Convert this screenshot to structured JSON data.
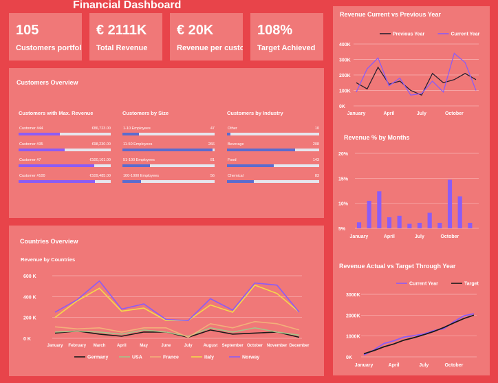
{
  "header": {
    "title": "Financial Dashboard"
  },
  "kpis": [
    {
      "value": "105",
      "label": "Customers portfolio"
    },
    {
      "value": "€ 2111K",
      "label": "Total Revenue"
    },
    {
      "value": "€ 20K",
      "label": "Revenue per customer"
    },
    {
      "value": "108%",
      "label": "Target Achieved"
    }
  ],
  "customers_overview": {
    "title": "Customers Overview",
    "blocks": [
      {
        "title": "Customers with Max. Revenue",
        "color": "#8b5cf6",
        "rows": [
          {
            "label": "Customer #44",
            "value": "€86,723.00",
            "fraction": 0.45
          },
          {
            "label": "Customer #35",
            "value": "€98,230.00",
            "fraction": 0.5
          },
          {
            "label": "Customer #7",
            "value": "€100,101.00",
            "fraction": 0.82
          },
          {
            "label": "Customer #100",
            "value": "€109,485.00",
            "fraction": 0.83
          }
        ]
      },
      {
        "title": "Customers by Size",
        "color": "#5b6ccf",
        "rows": [
          {
            "label": "1-10 Employees",
            "value": "47",
            "fraction": 0.18
          },
          {
            "label": "11-50 Employees",
            "value": "266",
            "fraction": 0.98
          },
          {
            "label": "51-100 Employees",
            "value": "81",
            "fraction": 0.3
          },
          {
            "label": "100-1000 Employees",
            "value": "56",
            "fraction": 0.2
          }
        ]
      },
      {
        "title": "Customers by Industry",
        "color": "#5b6ccf",
        "rows": [
          {
            "label": "Other",
            "value": "10",
            "fraction": 0.04
          },
          {
            "label": "Beverage",
            "value": "208",
            "fraction": 0.74
          },
          {
            "label": "Food",
            "value": "143",
            "fraction": 0.51
          },
          {
            "label": "Chemical",
            "value": "83",
            "fraction": 0.29
          }
        ]
      }
    ]
  },
  "countries_overview": {
    "title": "Countries Overview",
    "subtitle": "Revenue by Countries"
  },
  "chart_data": [
    {
      "type": "line",
      "title": "Revenue Current vs Previous Year",
      "x": [
        "January",
        "February",
        "March",
        "April",
        "May",
        "June",
        "July",
        "August",
        "September",
        "October",
        "November",
        "December"
      ],
      "xticks": [
        "January",
        "April",
        "July",
        "October"
      ],
      "yticks": [
        "0K",
        "100K",
        "200K",
        "300K",
        "400K"
      ],
      "ylim": [
        0,
        400
      ],
      "legend": "top",
      "series": [
        {
          "name": "Previous Year",
          "color": "#2a2030",
          "values": [
            150,
            110,
            250,
            140,
            160,
            100,
            70,
            210,
            150,
            170,
            210,
            170
          ]
        },
        {
          "name": "Current Year",
          "color": "#8b5cf6",
          "values": [
            90,
            240,
            310,
            130,
            180,
            70,
            80,
            160,
            90,
            340,
            280,
            100
          ]
        }
      ]
    },
    {
      "type": "bar",
      "title": "Revenue % by Months",
      "categories": [
        "January",
        "February",
        "March",
        "April",
        "May",
        "June",
        "July",
        "August",
        "September",
        "October",
        "November",
        "December"
      ],
      "xticks": [
        "January",
        "April",
        "July",
        "October"
      ],
      "yticks": [
        "5%",
        "10%",
        "15%",
        "20%"
      ],
      "ylim": [
        5,
        20
      ],
      "color": "#8b5cf6",
      "values": [
        6.2,
        10.5,
        12.4,
        7.2,
        7.5,
        5.9,
        6.1,
        8.1,
        6.1,
        14.7,
        11.4,
        6.1
      ]
    },
    {
      "type": "line",
      "title": "Revenue by Countries",
      "x": [
        "January",
        "February",
        "March",
        "April",
        "May",
        "June",
        "July",
        "August",
        "September",
        "October",
        "November",
        "December"
      ],
      "xticks": [
        "January",
        "February",
        "March",
        "April",
        "May",
        "June",
        "July",
        "August",
        "September",
        "October",
        "November",
        "December"
      ],
      "yticks": [
        "0 K",
        "200 K",
        "400 K",
        "600 K"
      ],
      "ylim": [
        0,
        600
      ],
      "legend": "bottom",
      "series": [
        {
          "name": "Germany",
          "color": "#1a1a1a",
          "values": [
            50,
            70,
            40,
            20,
            60,
            60,
            10,
            80,
            40,
            50,
            60,
            10
          ]
        },
        {
          "name": "USA",
          "color": "#a6c48a",
          "values": [
            60,
            70,
            60,
            40,
            80,
            60,
            20,
            100,
            60,
            100,
            60,
            30
          ]
        },
        {
          "name": "France",
          "color": "#f2b07a",
          "values": [
            110,
            90,
            100,
            60,
            100,
            100,
            10,
            140,
            100,
            160,
            140,
            80
          ]
        },
        {
          "name": "Italy",
          "color": "#f4d94a",
          "values": [
            200,
            360,
            480,
            260,
            290,
            170,
            170,
            320,
            250,
            510,
            430,
            250
          ]
        },
        {
          "name": "Norway",
          "color": "#8b5cf6",
          "values": [
            250,
            370,
            550,
            280,
            330,
            180,
            170,
            380,
            270,
            530,
            510,
            250
          ]
        }
      ]
    },
    {
      "type": "line",
      "title": "Revenue Actual vs Target Through Year",
      "x": [
        "January",
        "February",
        "March",
        "April",
        "May",
        "June",
        "July",
        "August",
        "September",
        "October",
        "November",
        "December"
      ],
      "xticks": [
        "January",
        "April",
        "July",
        "October"
      ],
      "yticks": [
        "0K",
        "1000K",
        "2000K",
        "3000K"
      ],
      "ylim": [
        0,
        3000
      ],
      "legend": "top",
      "series": [
        {
          "name": "Current Year",
          "color": "#8b5cf6",
          "values": [
            90,
            330,
            640,
            770,
            950,
            1020,
            1100,
            1260,
            1350,
            1690,
            1970,
            2070
          ]
        },
        {
          "name": "Target",
          "color": "#1a1a1a",
          "values": [
            150,
            300,
            480,
            620,
            800,
            920,
            1060,
            1220,
            1410,
            1630,
            1840,
            2000
          ]
        }
      ]
    }
  ]
}
